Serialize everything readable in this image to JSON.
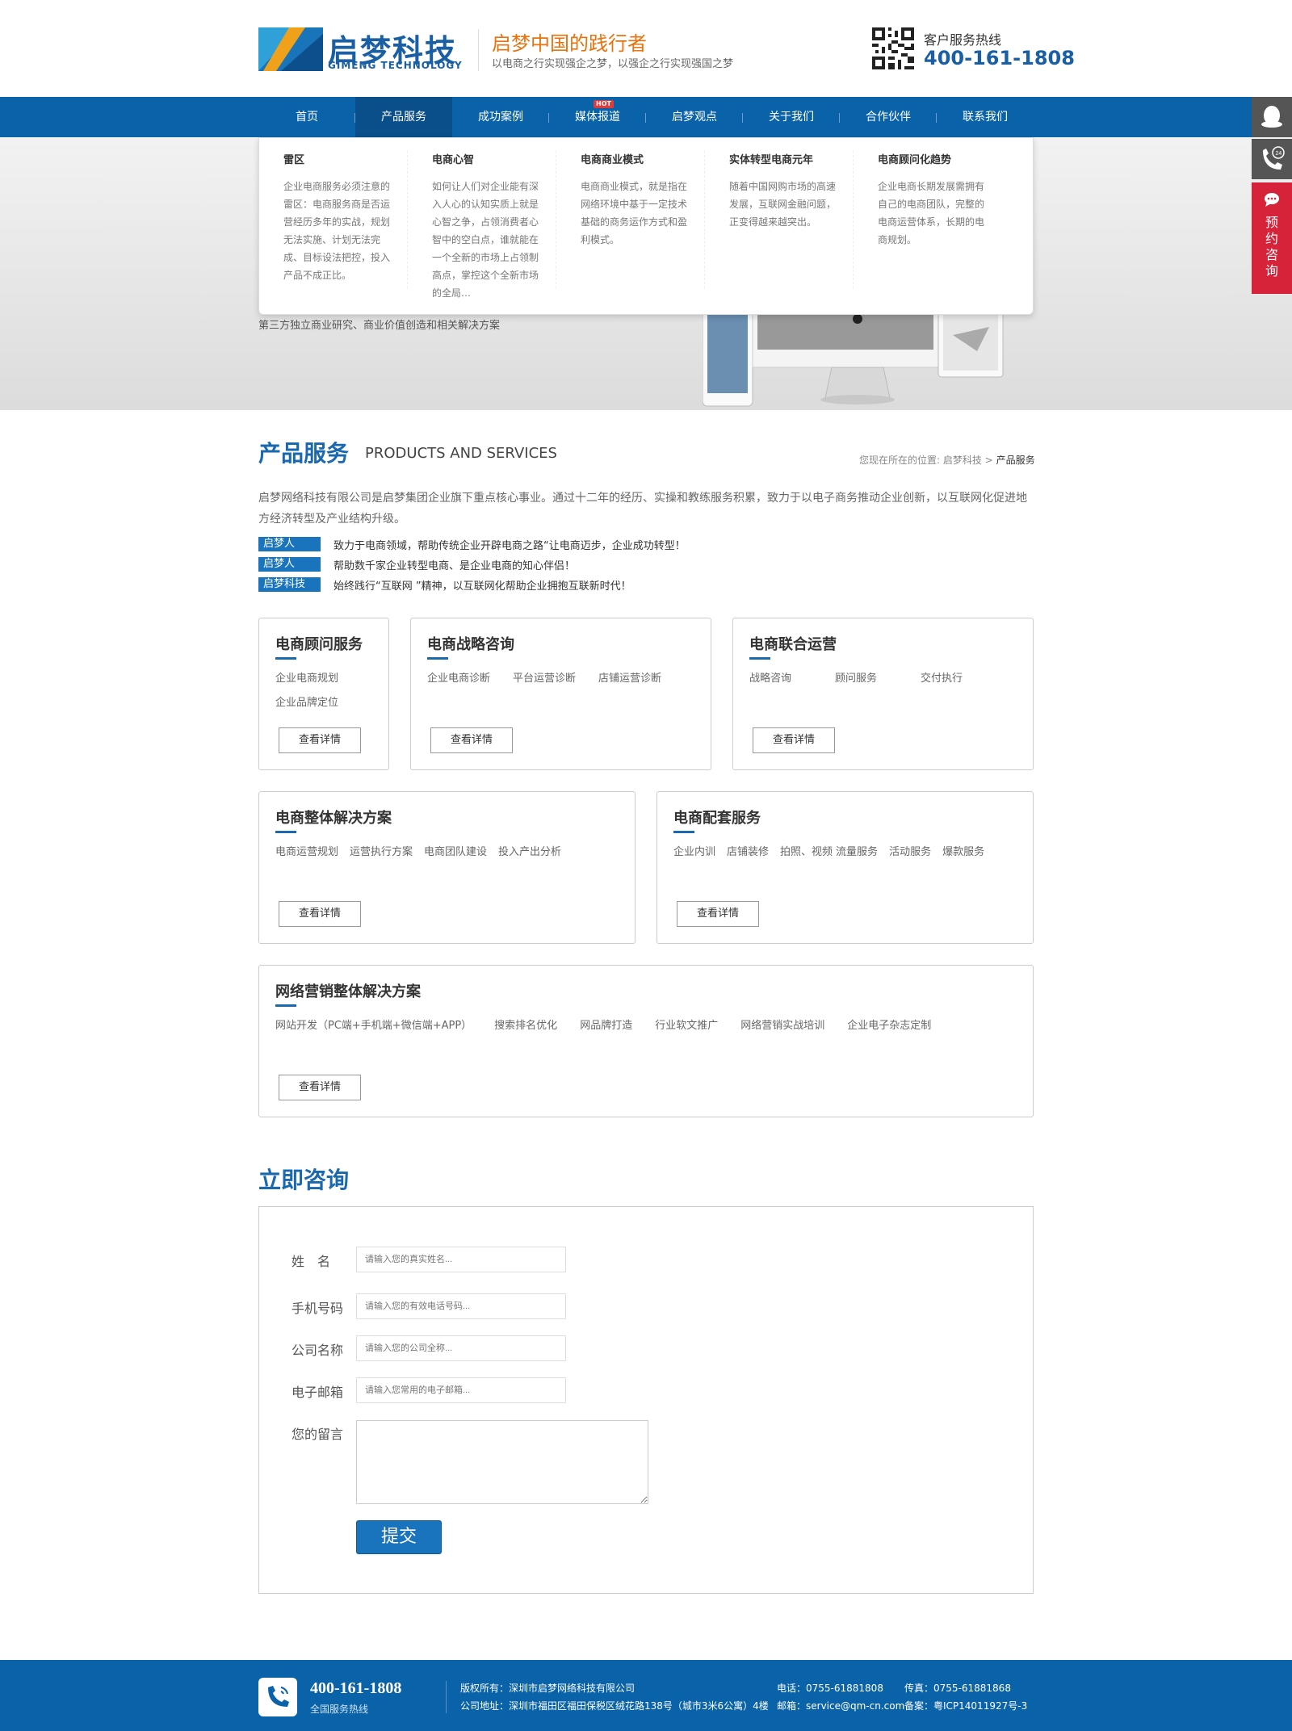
{
  "header": {
    "logo_cn": "启梦科技",
    "logo_en": "GIMENG TECHNOLOGY",
    "slogan": "启梦中国的践行者",
    "slogan_sub": "以电商之行实现强企之梦，以强企之行实现强国之梦",
    "hotline_label": "客户服务热线",
    "hotline_number": "400-161-1808"
  },
  "nav": {
    "items": [
      {
        "label": "首页"
      },
      {
        "label": "产品服务"
      },
      {
        "label": "成功案例"
      },
      {
        "label": "媒体报道"
      },
      {
        "label": "启梦观点"
      },
      {
        "label": "关于我们"
      },
      {
        "label": "合作伙伴"
      },
      {
        "label": "联系我们"
      }
    ],
    "hot_badge": "HOT"
  },
  "dropdown": [
    {
      "title": "雷区",
      "desc": "企业电商服务必须注意的雷区：电商服务商是否运营经历多年的实战，规划无法实施、计划无法完成、目标设法把控，投入产品不成正比。"
    },
    {
      "title": "电商心智",
      "desc": "如何让人们对企业能有深入人心的认知实质上就是心智之争，占领消费者心智中的空白点，谁就能在一个全新的市场上占领制高点，掌控这个全新市场的全局…"
    },
    {
      "title": "电商商业模式",
      "desc": "电商商业模式，就是指在网络环境中基于一定技术基础的商务运作方式和盈利模式。"
    },
    {
      "title": "实体转型电商元年",
      "desc": "随着中国网购市场的高速发展，互联网金融问题，正变得越来越突出。"
    },
    {
      "title": "电商顾问化趋势",
      "desc": "企业电商长期发展需拥有自己的电商团队，完整的电商运营体系，长期的电商规划。"
    }
  ],
  "banner": {
    "text": "第三方独立商业研究、商业价值创造和相关解决方案"
  },
  "sidebar": {
    "book_label": "预约咨询"
  },
  "section": {
    "title": "产品服务",
    "title_en": "PRODUCTS AND SERVICES",
    "breadcrumb_prefix": "您现在所在的位置: 启梦科技 >",
    "breadcrumb_current": "产品服务",
    "intro": "启梦网络科技有限公司是启梦集团企业旗下重点核心事业。通过十二年的经历、实操和教练服务积累，致力于以电子商务推动企业创新，以互联网化促进地方经济转型及产业结构升级。",
    "tags": [
      {
        "tag": "启梦人",
        "text": "致力于电商领域，帮助传统企业开辟电商之路“让电商迈步，企业成功转型！"
      },
      {
        "tag": "启梦人",
        "text": "帮助数千家企业转型电商、是企业电商的知心伴侣！"
      },
      {
        "tag": "启梦科技",
        "text": "始终践行“互联网 ”精神，以互联网化帮助企业拥抱互联新时代！"
      }
    ]
  },
  "cards": [
    {
      "title": "电商顾问服务",
      "items": [
        "企业电商规划",
        "企业品牌定位"
      ],
      "button": "查看详情"
    },
    {
      "title": "电商战略咨询",
      "items": [
        "企业电商诊断",
        "平台运营诊断",
        "店铺运营诊断"
      ],
      "button": "查看详情"
    },
    {
      "title": "电商联合运营",
      "items": [
        "战略咨询",
        "顾问服务",
        "交付执行"
      ],
      "button": "查看详情"
    },
    {
      "title": "电商整体解决方案",
      "items": [
        "电商运营规划",
        "运营执行方案",
        "电商团队建设",
        "投入产出分析"
      ],
      "button": "查看详情"
    },
    {
      "title": "电商配套服务",
      "items": [
        "企业内训",
        "店铺装修",
        "拍照、视频",
        "流量服务",
        "活动服务",
        "爆款服务"
      ],
      "button": "查看详情"
    },
    {
      "title": "网络营销整体解决方案",
      "items": [
        "网站开发（PC端+手机端+微信端+APP）",
        "搜索排名优化",
        "网品牌打造",
        "行业软文推广",
        "网络营销实战培训",
        "企业电子杂志定制"
      ],
      "button": "查看详情"
    }
  ],
  "consult": {
    "title": "立即咨询",
    "fields": [
      {
        "label": "姓　名",
        "placeholder": "请输入您的真实姓名..."
      },
      {
        "label": "手机号码",
        "placeholder": "请输入您的有效电话号码..."
      },
      {
        "label": "公司名称",
        "placeholder": "请输入您的公司全称..."
      },
      {
        "label": "电子邮箱",
        "placeholder": "请输入您常用的电子邮箱..."
      }
    ],
    "message_label": "您的留言",
    "submit": "提交"
  },
  "footer": {
    "hotline": "400-161-1808",
    "hotline_sub": "全国服务热线",
    "copyright": "版权所有：深圳市启梦网络科技有限公司",
    "address": "公司地址：深圳市福田区福田保税区绒花路138号（城市3米6公寓）4楼",
    "tel": "电话：0755-61881808",
    "fax": "传真：0755-61881868",
    "email": "邮箱：service@qm-cn.com",
    "icp": "备案：粤ICP14011927号-3"
  },
  "colors": {
    "brand_blue": "#0a63a8",
    "accent_orange": "#e8720c",
    "book_red": "#d6233a"
  }
}
